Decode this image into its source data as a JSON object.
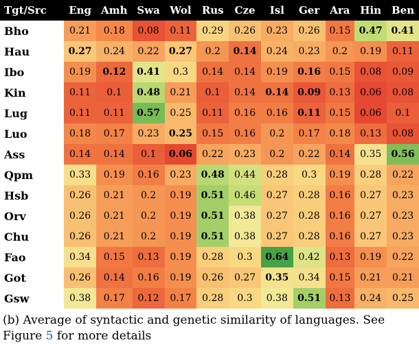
{
  "caption_prefix": "(b) Average of syntactic and genetic similarity of languages. See Figure ",
  "caption_link": "5",
  "caption_suffix": " for more details",
  "corner_label": "Tgt/Src",
  "chart_data": {
    "type": "heatmap",
    "xlabel": "",
    "ylabel": "",
    "title": "",
    "value_range": [
      0.06,
      0.64
    ],
    "columns": [
      "Eng",
      "Amh",
      "Swa",
      "Wol",
      "Rus",
      "Cze",
      "Isl",
      "Ger",
      "Ara",
      "Hin",
      "Ben"
    ],
    "rows": [
      "Bho",
      "Hau",
      "Ibo",
      "Kin",
      "Lug",
      "Luo",
      "Ass",
      "Qpm",
      "Hsb",
      "Orv",
      "Chu",
      "Fao",
      "Got",
      "Gsw"
    ],
    "values": [
      [
        0.21,
        0.18,
        0.08,
        0.11,
        0.29,
        0.26,
        0.23,
        0.26,
        0.15,
        0.47,
        0.41
      ],
      [
        0.27,
        0.24,
        0.22,
        0.27,
        0.2,
        0.14,
        0.24,
        0.23,
        0.2,
        0.19,
        0.11
      ],
      [
        0.19,
        0.12,
        0.41,
        0.3,
        0.14,
        0.14,
        0.19,
        0.16,
        0.15,
        0.08,
        0.09
      ],
      [
        0.11,
        0.1,
        0.48,
        0.21,
        0.1,
        0.14,
        0.14,
        0.09,
        0.13,
        0.06,
        0.08
      ],
      [
        0.11,
        0.11,
        0.57,
        0.25,
        0.11,
        0.16,
        0.16,
        0.11,
        0.15,
        0.06,
        0.1
      ],
      [
        0.18,
        0.17,
        0.23,
        0.25,
        0.15,
        0.16,
        0.2,
        0.17,
        0.18,
        0.13,
        0.08
      ],
      [
        0.14,
        0.14,
        0.1,
        0.06,
        0.22,
        0.23,
        0.2,
        0.22,
        0.14,
        0.35,
        0.56
      ],
      [
        0.33,
        0.19,
        0.16,
        0.23,
        0.48,
        0.44,
        0.28,
        0.3,
        0.19,
        0.28,
        0.22
      ],
      [
        0.26,
        0.21,
        0.2,
        0.19,
        0.51,
        0.46,
        0.27,
        0.28,
        0.16,
        0.27,
        0.23
      ],
      [
        0.26,
        0.21,
        0.2,
        0.19,
        0.51,
        0.38,
        0.27,
        0.28,
        0.16,
        0.27,
        0.23
      ],
      [
        0.26,
        0.21,
        0.2,
        0.19,
        0.51,
        0.38,
        0.27,
        0.28,
        0.16,
        0.27,
        0.23
      ],
      [
        0.34,
        0.15,
        0.13,
        0.19,
        0.28,
        0.3,
        0.64,
        0.42,
        0.13,
        0.19,
        0.22
      ],
      [
        0.26,
        0.14,
        0.16,
        0.19,
        0.26,
        0.27,
        0.35,
        0.34,
        0.15,
        0.21,
        0.21
      ],
      [
        0.38,
        0.17,
        0.12,
        0.17,
        0.28,
        0.3,
        0.38,
        0.51,
        0.13,
        0.24,
        0.25
      ]
    ],
    "bold_cells": [
      [
        0,
        9
      ],
      [
        0,
        10
      ],
      [
        1,
        0
      ],
      [
        1,
        3
      ],
      [
        1,
        5
      ],
      [
        2,
        1
      ],
      [
        2,
        2
      ],
      [
        2,
        7
      ],
      [
        3,
        2
      ],
      [
        3,
        6
      ],
      [
        3,
        7
      ],
      [
        4,
        2
      ],
      [
        4,
        7
      ],
      [
        5,
        3
      ],
      [
        6,
        3
      ],
      [
        6,
        10
      ],
      [
        7,
        4
      ],
      [
        8,
        4
      ],
      [
        9,
        4
      ],
      [
        10,
        4
      ],
      [
        11,
        6
      ],
      [
        12,
        6
      ],
      [
        13,
        7
      ]
    ]
  }
}
